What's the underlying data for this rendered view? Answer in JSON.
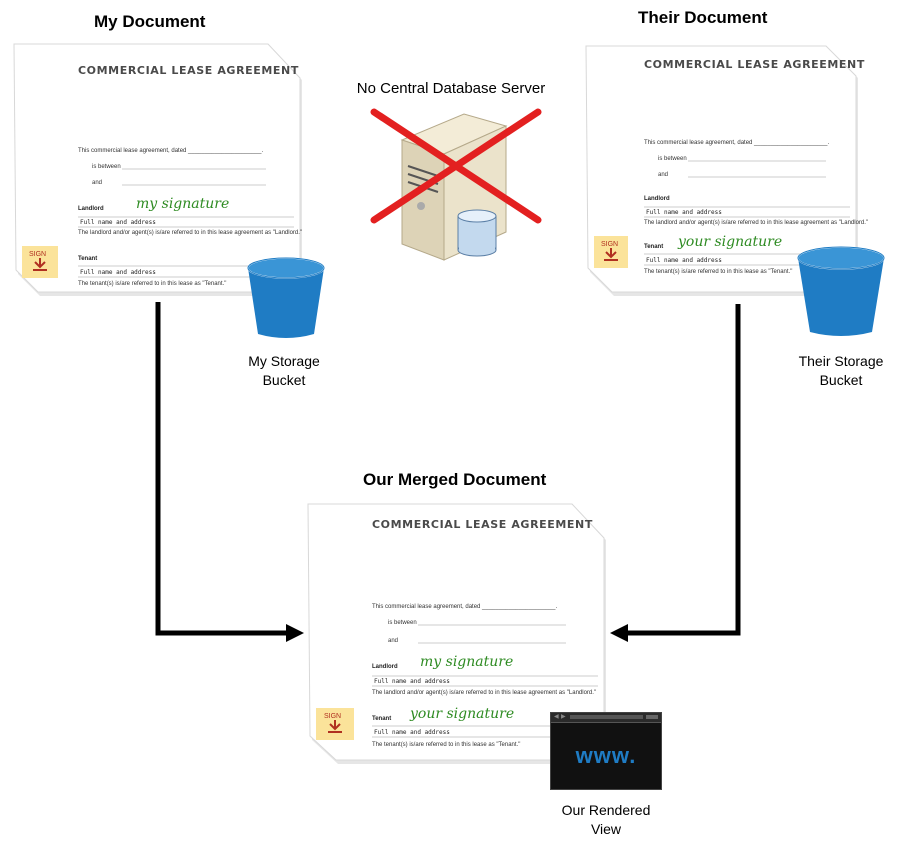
{
  "headings": {
    "my_document": "My Document",
    "their_document": "Their Document",
    "merged_document": "Our Merged Document"
  },
  "labels": {
    "server": "No Central Database Server",
    "my_bucket_line1": "My Storage",
    "my_bucket_line2": "Bucket",
    "their_bucket_line1": "Their Storage",
    "their_bucket_line2": "Bucket",
    "rendered_line1": "Our Rendered",
    "rendered_line2": "View"
  },
  "document": {
    "title": "COMMERCIAL LEASE AGREEMENT",
    "intro": "This commercial lease agreement, dated ______________________.",
    "is_between": "is between",
    "and": "and",
    "landlord": "Landlord",
    "tenant": "Tenant",
    "full_name": "Full name and address",
    "landlord_note": "The landlord and/or agent(s) is/are referred to in this lease agreement as \"Landlord.\"",
    "tenant_note": "The tenant(s) is/are referred to in this lease as \"Tenant.\"",
    "sign": "SIGN"
  },
  "signatures": {
    "mine": "my signature",
    "theirs": "your signature"
  },
  "browser": {
    "text": "www."
  },
  "colors": {
    "bucket": "#1f7cc4",
    "bucket_rim": "#3a95d6",
    "arrow": "#000000",
    "cross": "#e32020",
    "signature": "#2e8b22",
    "sign_tab": "#fbe39a"
  }
}
